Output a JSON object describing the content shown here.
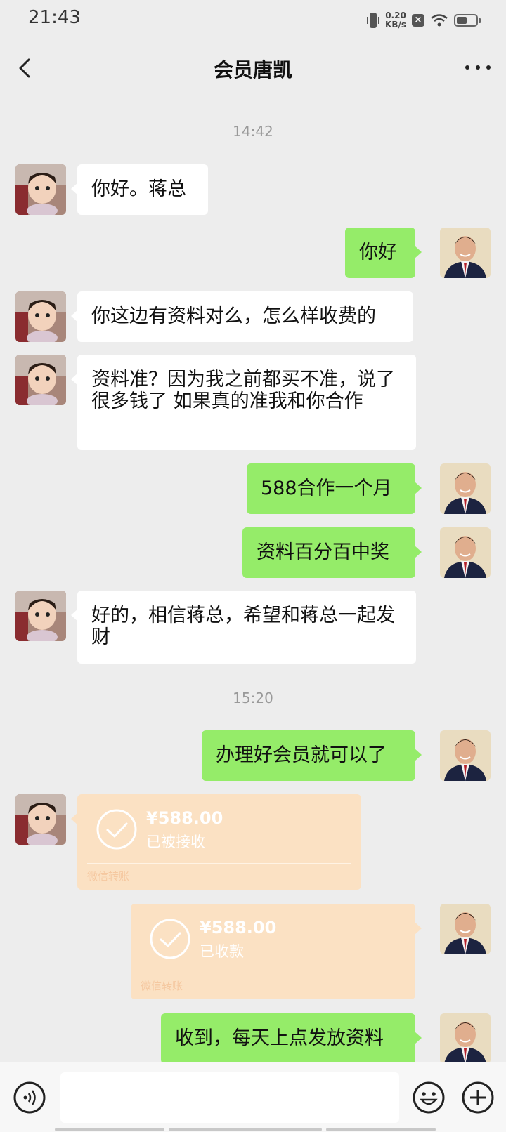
{
  "status_bar": {
    "time": "21:43",
    "net_speed": "0.20",
    "net_unit": "KB/s"
  },
  "header": {
    "title": "会员唐凯"
  },
  "timestamps": [
    "14:42",
    "15:20"
  ],
  "messages": [
    {
      "from": "them",
      "text": "你好。蒋总"
    },
    {
      "from": "me",
      "text": "你好"
    },
    {
      "from": "them",
      "text": "你这边有资料对么，怎么样收费的"
    },
    {
      "from": "them",
      "text": "资料准？因为我之前都买不准，说了很多钱了 如果真的准我和你合作"
    },
    {
      "from": "me",
      "text": "588合作一个月"
    },
    {
      "from": "me",
      "text": "资料百分百中奖"
    },
    {
      "from": "them",
      "text": "好的，相信蒋总，希望和蒋总一起发财"
    },
    {
      "from": "me",
      "text": "办理好会员就可以了"
    },
    {
      "from": "them",
      "type": "transfer",
      "amount": "¥588.00",
      "status": "已被接收",
      "label": "微信转账"
    },
    {
      "from": "me",
      "type": "transfer",
      "amount": "¥588.00",
      "status": "已收款",
      "label": "微信转账"
    },
    {
      "from": "me",
      "text": "收到，每天上点发放资料"
    }
  ],
  "colors": {
    "background": "#ededed",
    "outgoing_bubble": "#95ec69",
    "incoming_bubble": "#ffffff",
    "transfer_card": "#fbe1c3"
  },
  "icons": [
    "back-arrow-icon",
    "more-dots-icon",
    "voice-icon",
    "emoji-icon",
    "plus-icon"
  ]
}
